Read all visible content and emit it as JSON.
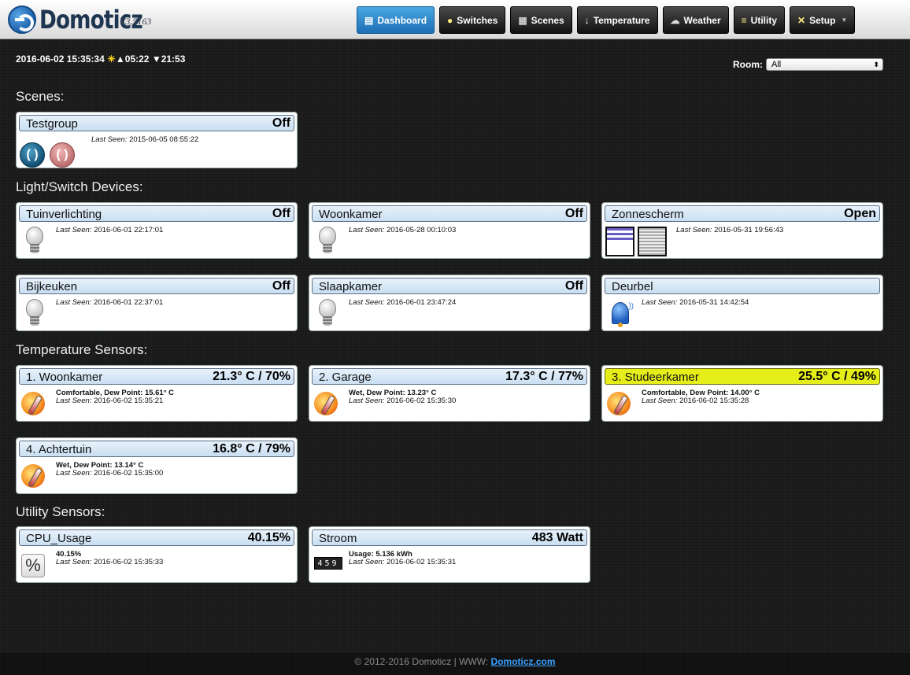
{
  "brand": {
    "name": "Domoticz",
    "version": "V3.5163"
  },
  "nav": [
    {
      "label": "Dashboard",
      "icon": "dashboard-icon"
    },
    {
      "label": "Switches",
      "icon": "bulb-icon"
    },
    {
      "label": "Scenes",
      "icon": "scenes-icon"
    },
    {
      "label": "Temperature",
      "icon": "thermometer-icon"
    },
    {
      "label": "Weather",
      "icon": "weather-icon"
    },
    {
      "label": "Utility",
      "icon": "utility-icon"
    },
    {
      "label": "Setup",
      "icon": "setup-icon"
    }
  ],
  "datetime": {
    "date": "2016-06-02 15:35:34",
    "sunrise": "05:22",
    "sunset": "21:53"
  },
  "room": {
    "label": "Room:",
    "value": "All"
  },
  "sections": {
    "scenes": "Scenes:",
    "lights": "Light/Switch Devices:",
    "temperature": "Temperature Sensors:",
    "utility": "Utility Sensors:"
  },
  "last_seen_label": "Last Seen:",
  "scenes": [
    {
      "name": "Testgroup",
      "status": "Off",
      "last_seen": "2015-06-05 08:55:22"
    }
  ],
  "lights": [
    {
      "name": "Tuinverlichting",
      "status": "Off",
      "last_seen": "2016-06-01 22:17:01"
    },
    {
      "name": "Woonkamer",
      "status": "Off",
      "last_seen": "2016-05-28 00:10:03"
    },
    {
      "name": "Zonnescherm",
      "status": "Open",
      "last_seen": "2016-05-31 19:56:43"
    },
    {
      "name": "Bijkeuken",
      "status": "Off",
      "last_seen": "2016-06-01 22:37:01"
    },
    {
      "name": "Slaapkamer",
      "status": "Off",
      "last_seen": "2016-06-01 23:47:24"
    },
    {
      "name": "Deurbel",
      "status": "",
      "last_seen": "2016-05-31 14:42:54"
    }
  ],
  "temperature": [
    {
      "name": "1. Woonkamer",
      "status": "21.3° C / 70%",
      "detail": "Comfortable, Dew Point: 15.61° C",
      "last_seen": "2016-06-02 15:35:21"
    },
    {
      "name": "2. Garage",
      "status": "17.3° C / 77%",
      "detail": "Wet, Dew Point: 13.23° C",
      "last_seen": "2016-06-02 15:35:30"
    },
    {
      "name": "3. Studeerkamer",
      "status": "25.5° C / 49%",
      "detail": "Comfortable, Dew Point: 14.00° C",
      "last_seen": "2016-06-02 15:35:28",
      "highlight": "#e6ee1a"
    },
    {
      "name": "4. Achtertuin",
      "status": "16.8° C / 79%",
      "detail": "Wet, Dew Point: 13.14° C",
      "last_seen": "2016-06-02 15:35:00"
    }
  ],
  "utility": [
    {
      "name": "CPU_Usage",
      "status": "40.15%",
      "detail": "40.15%",
      "last_seen": "2016-06-02 15:35:33",
      "icon_text": "%"
    },
    {
      "name": "Stroom",
      "status": "483 Watt",
      "detail": "Usage: 5.136 kWh",
      "last_seen": "2016-06-02 15:35:31",
      "icon_text": "459"
    }
  ],
  "footer": {
    "text": "© 2012-2016 Domoticz | WWW: ",
    "link": "Domoticz.com"
  }
}
